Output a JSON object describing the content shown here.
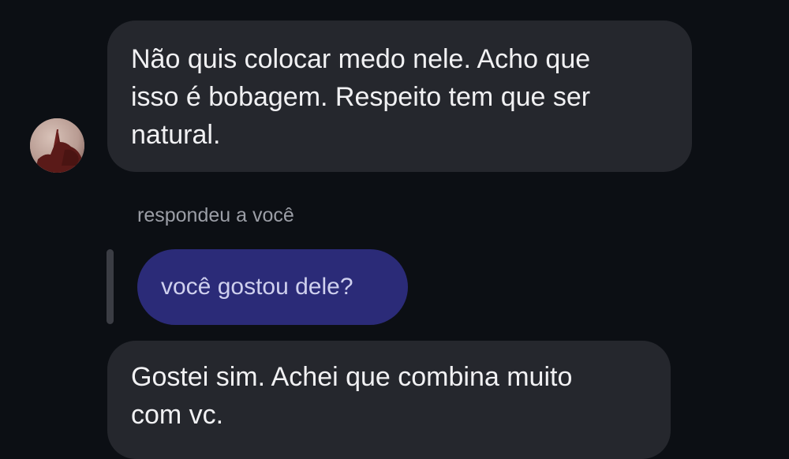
{
  "messages": [
    {
      "sender": "other",
      "lines": [
        "Não quis colocar medo nele. Acho que",
        "isso é bobagem. Respeito tem que ser",
        "natural."
      ]
    },
    {
      "sender": "other",
      "reply_caption": "respondeu a você",
      "quoted_text": "você gostou dele?",
      "lines": [
        "Gostei sim. Achei que combina muito",
        "com vc."
      ]
    }
  ],
  "colors": {
    "background": "#0c0f14",
    "incoming_bubble": "#25272d",
    "outgoing_quoted_bubble": "#2b2b78",
    "caption_text": "#9b9ea6"
  },
  "icons": {
    "avatar": "contact-avatar-photo"
  }
}
